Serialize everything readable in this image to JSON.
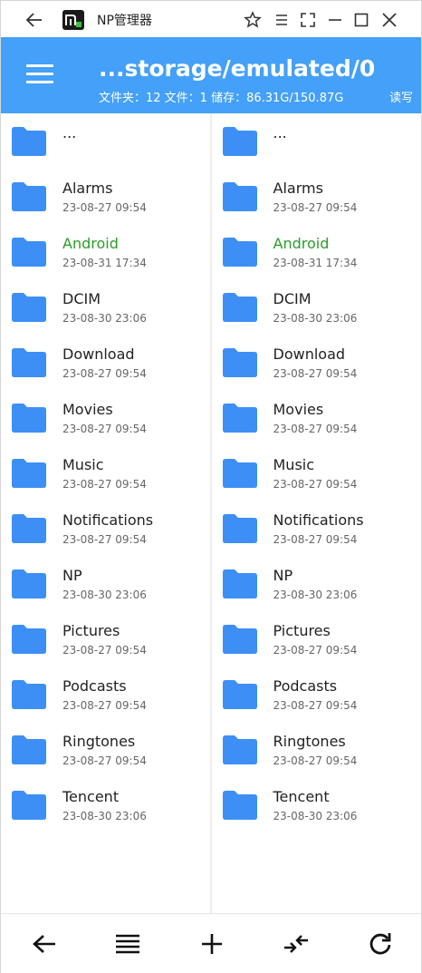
{
  "app": {
    "title": "NP管理器"
  },
  "header": {
    "path": "...storage/emulated/0",
    "stats": "文件夹：12 文件：1  储存：86.31G/150.87G",
    "rw_label": "读写"
  },
  "colors": {
    "accent": "#44a0f8",
    "folder": "#3d8ff5",
    "highlight_name": "#2a9c2a"
  },
  "parent_entry": "...",
  "left_pane": {
    "items": [
      {
        "name": "Alarms",
        "date": "23-08-27 09:54"
      },
      {
        "name": "Android",
        "date": "23-08-31 17:34"
      },
      {
        "name": "DCIM",
        "date": "23-08-30 23:06"
      },
      {
        "name": "Download",
        "date": "23-08-27 09:54"
      },
      {
        "name": "Movies",
        "date": "23-08-27 09:54"
      },
      {
        "name": "Music",
        "date": "23-08-27 09:54"
      },
      {
        "name": "Notifications",
        "date": "23-08-27 09:54"
      },
      {
        "name": "NP",
        "date": "23-08-30 23:06"
      },
      {
        "name": "Pictures",
        "date": "23-08-27 09:54"
      },
      {
        "name": "Podcasts",
        "date": "23-08-27 09:54"
      },
      {
        "name": "Ringtones",
        "date": "23-08-27 09:54"
      },
      {
        "name": "Tencent",
        "date": "23-08-30 23:06"
      }
    ]
  },
  "right_pane": {
    "items": [
      {
        "name": "Alarms",
        "date": "23-08-27 09:54"
      },
      {
        "name": "Android",
        "date": "23-08-31 17:34"
      },
      {
        "name": "DCIM",
        "date": "23-08-30 23:06"
      },
      {
        "name": "Download",
        "date": "23-08-27 09:54"
      },
      {
        "name": "Movies",
        "date": "23-08-27 09:54"
      },
      {
        "name": "Music",
        "date": "23-08-27 09:54"
      },
      {
        "name": "Notifications",
        "date": "23-08-27 09:54"
      },
      {
        "name": "NP",
        "date": "23-08-30 23:06"
      },
      {
        "name": "Pictures",
        "date": "23-08-27 09:54"
      },
      {
        "name": "Podcasts",
        "date": "23-08-27 09:54"
      },
      {
        "name": "Ringtones",
        "date": "23-08-27 09:54"
      },
      {
        "name": "Tencent",
        "date": "23-08-30 23:06"
      }
    ]
  },
  "toolbar_icons": [
    "back-arrow-icon",
    "list-menu-icon",
    "plus-icon",
    "swap-panes-icon",
    "refresh-icon"
  ]
}
